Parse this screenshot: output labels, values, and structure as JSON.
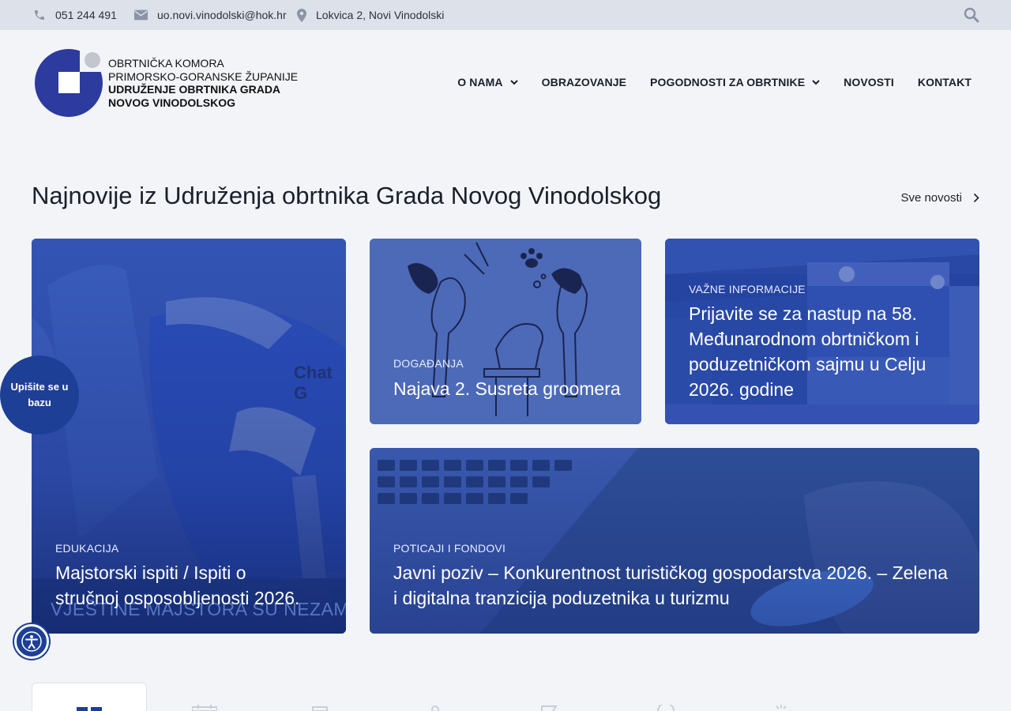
{
  "topbar": {
    "phone": "051 244 491",
    "email": "uo.novi.vinodolski@hok.hr",
    "address": "Lokvica 2, Novi Vinodolski"
  },
  "logo": {
    "line1": "OBRTNIČKA KOMORA",
    "line2": "PRIMORSKO-GORANSKE ŽUPANIJE",
    "line3": "UDRUŽENJE OBRTNIKA GRADA",
    "line4": "NOVOG VINODOLSKOG"
  },
  "nav": {
    "items": [
      {
        "label": "O NAMA",
        "dropdown": true
      },
      {
        "label": "OBRAZOVANJE",
        "dropdown": false
      },
      {
        "label": "POGODNOSTI ZA OBRTNIKE",
        "dropdown": true
      },
      {
        "label": "NOVOSTI",
        "dropdown": false
      },
      {
        "label": "KONTAKT",
        "dropdown": false
      }
    ]
  },
  "section": {
    "title": "Najnovije iz Udruženja obrtnika Grada Novog Vinodolskog",
    "all_news": "Sve novosti"
  },
  "cards": [
    {
      "category": "EDUKACIJA",
      "title_line1": "Majstorski ispiti / Ispiti o",
      "title_line2": "stručnoj osposobljenosti 2026."
    },
    {
      "category": "DOGAĐANJA",
      "title_line1": "Najava 2. Susreta groomera"
    },
    {
      "category": "VAŽNE INFORMACIJE",
      "title_line1": "Prijavite se za nastup na 58.",
      "title_line2": "Međunarodnom obrtničkom i",
      "title_line3": "poduzetničkom sajmu u Celju",
      "title_line4": "2026. godine"
    },
    {
      "category": "POTICAJI I FONDOVI",
      "title_line1": "Javni poziv – Konkurentnost turističkog gospodarstva 2026. – Zelena",
      "title_line2": "i digitalna tranzicija poduzetnika u turizmu"
    }
  ],
  "image_text": {
    "chat_g": "Chat G",
    "banner": "VJEŠTINE MAJSTORA SU NEZAMJENJIV"
  },
  "float_cta": "Upišite se u bazu",
  "colors": {
    "accent": "#1e3f96",
    "topbar": "#dde2ea",
    "background": "#f2f4f8"
  }
}
